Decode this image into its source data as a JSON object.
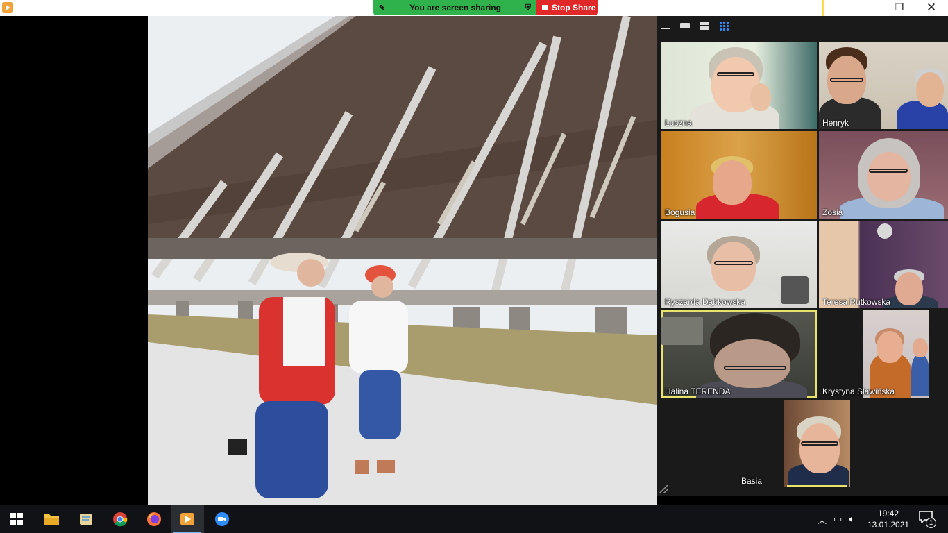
{
  "window": {
    "minimize_glyph": "—",
    "maximize_glyph": "❐",
    "close_glyph": "✕"
  },
  "share_bar": {
    "status_text": "You are screen sharing",
    "stop_label": "Stop Share"
  },
  "gallery": {
    "participants": [
      {
        "name": "Luczna"
      },
      {
        "name": "Henryk"
      },
      {
        "name": "Bogusia"
      },
      {
        "name": "Zosia"
      },
      {
        "name": "Ryszarda Dąbkowska"
      },
      {
        "name": "Teresa Rutkowska"
      },
      {
        "name": "Halina TERENDA",
        "active_speaker": true
      },
      {
        "name": "Krystyna Sławińska"
      },
      {
        "name": "Basia"
      }
    ]
  },
  "taskbar": {
    "apps": [
      "windows-start",
      "file-explorer",
      "notes",
      "chrome",
      "firefox",
      "media-player",
      "zoom"
    ],
    "time": "19:42",
    "date": "13.01.2021",
    "notification_count": "1"
  },
  "colors": {
    "share_green": "#2fb24b",
    "stop_red": "#e02828",
    "active_speaker_border": "#e7e36b",
    "grid_view_blue": "#2d8cff"
  }
}
